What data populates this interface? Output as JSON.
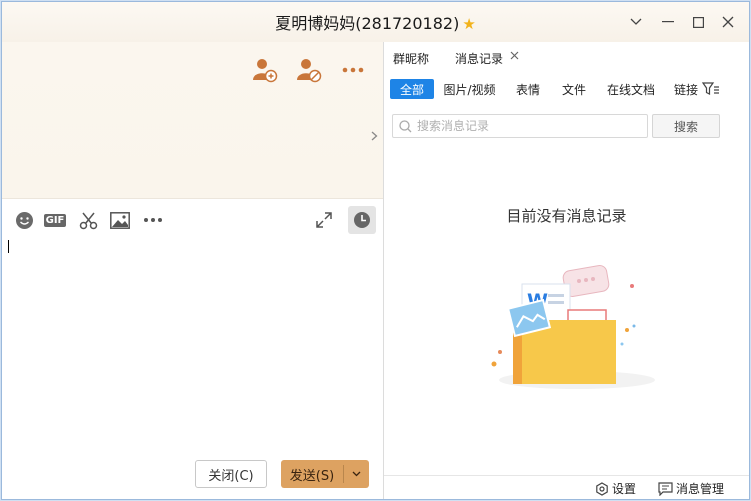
{
  "window": {
    "title": "夏明博妈妈(281720182)",
    "star": "★",
    "controls": {
      "dropdown": "⌵",
      "minimize": "—",
      "maximize": "☐",
      "close": "✕"
    }
  },
  "chat_header_icons": [
    "add-member-icon",
    "remove-member-icon",
    "more-icon"
  ],
  "composer": {
    "toolbar": [
      "emoji-icon",
      "gif-icon",
      "scissors-icon",
      "image-icon",
      "more-icon",
      "expand-icon",
      "history-clock-icon"
    ],
    "gif_label": "GIF",
    "close_label": "关闭(C)",
    "send_label": "发送(S)"
  },
  "side_panel": {
    "tabs": [
      {
        "label": "群昵称"
      },
      {
        "label": "消息记录",
        "closable": true
      }
    ],
    "filters": [
      "全部",
      "图片/视频",
      "表情",
      "文件",
      "在线文档",
      "链接"
    ],
    "active_filter": "全部",
    "search": {
      "placeholder": "搜索消息记录",
      "value": "",
      "button": "搜索"
    },
    "empty_text": "目前没有消息记录",
    "footer": {
      "settings": "设置",
      "manage": "消息管理"
    }
  },
  "colors": {
    "accent": "#1e84e6",
    "send_button": "#dda261",
    "title_star": "#f2b21a"
  }
}
